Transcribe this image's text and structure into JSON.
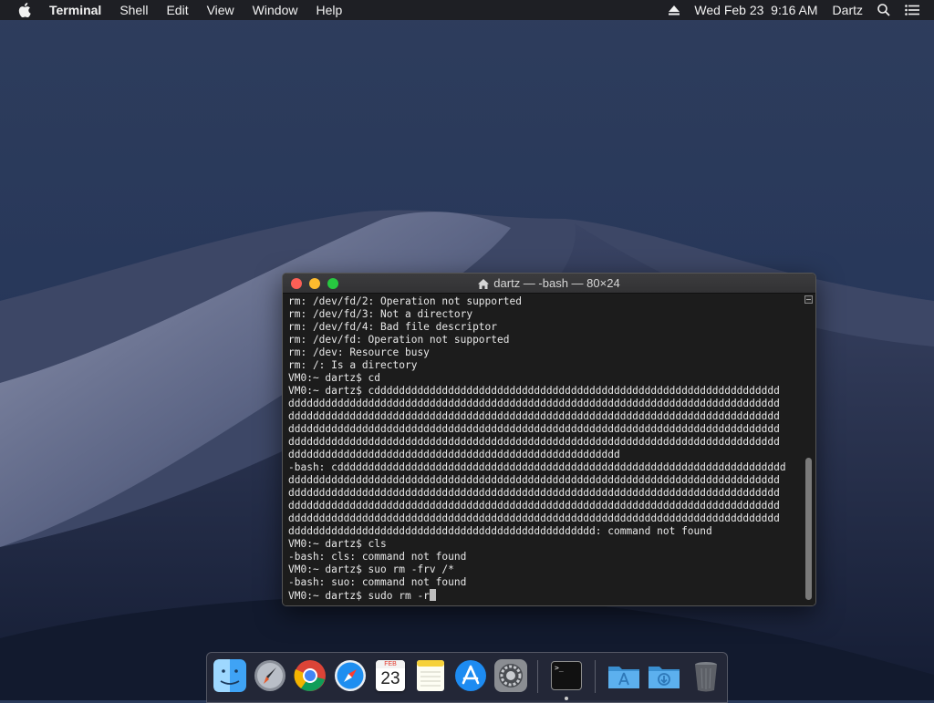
{
  "menubar": {
    "app_name": "Terminal",
    "items": [
      "Shell",
      "Edit",
      "View",
      "Window",
      "Help"
    ],
    "datetime": "Wed Feb 23  9:16 AM",
    "user": "Dartz",
    "icons": [
      "apple-icon",
      "eject-icon",
      "search-icon",
      "notification-list-icon"
    ]
  },
  "terminal": {
    "title": "dartz — -bash — 80×24",
    "lines": [
      "rm: /dev/fd/2: Operation not supported",
      "rm: /dev/fd/3: Not a directory",
      "rm: /dev/fd/4: Bad file descriptor",
      "rm: /dev/fd: Operation not supported",
      "rm: /dev: Resource busy",
      "rm: /: Is a directory",
      "VM0:~ dartz$ cd",
      "VM0:~ dartz$ cdddddddddddddddddddddddddddddddddddddddddddddddddddddddddddddddddd",
      "dddddddddddddddddddddddddddddddddddddddddddddddddddddddddddddddddddddddddddddddd",
      "dddddddddddddddddddddddddddddddddddddddddddddddddddddddddddddddddddddddddddddddd",
      "dddddddddddddddddddddddddddddddddddddddddddddddddddddddddddddddddddddddddddddddd",
      "dddddddddddddddddddddddddddddddddddddddddddddddddddddddddddddddddddddddddddddddd",
      "dddddddddddddddddddddddddddddddddddddddddddddddddddddd",
      "-bash: cddddddddddddddddddddddddddddddddddddddddddddddddddddddddddddddddddddddddd",
      "dddddddddddddddddddddddddddddddddddddddddddddddddddddddddddddddddddddddddddddddd",
      "dddddddddddddddddddddddddddddddddddddddddddddddddddddddddddddddddddddddddddddddd",
      "dddddddddddddddddddddddddddddddddddddddddddddddddddddddddddddddddddddddddddddddd",
      "dddddddddddddddddddddddddddddddddddddddddddddddddddddddddddddddddddddddddddddddd",
      "dddddddddddddddddddddddddddddddddddddddddddddddddd: command not found",
      "VM0:~ dartz$ cls",
      "-bash: cls: command not found",
      "VM0:~ dartz$ suo rm -frv /*",
      "-bash: suo: command not found",
      "VM0:~ dartz$ sudo rm -r"
    ]
  },
  "dock": {
    "apps": [
      {
        "name": "finder-icon"
      },
      {
        "name": "launchpad-icon"
      },
      {
        "name": "chrome-icon"
      },
      {
        "name": "safari-icon"
      },
      {
        "name": "calendar-icon",
        "month": "FEB",
        "day": "23"
      },
      {
        "name": "notes-icon"
      },
      {
        "name": "app-store-icon"
      },
      {
        "name": "system-preferences-icon"
      },
      {
        "name": "terminal-icon",
        "label": ">_"
      },
      {
        "name": "applications-folder-icon"
      },
      {
        "name": "downloads-folder-icon"
      },
      {
        "name": "trash-icon"
      }
    ]
  }
}
